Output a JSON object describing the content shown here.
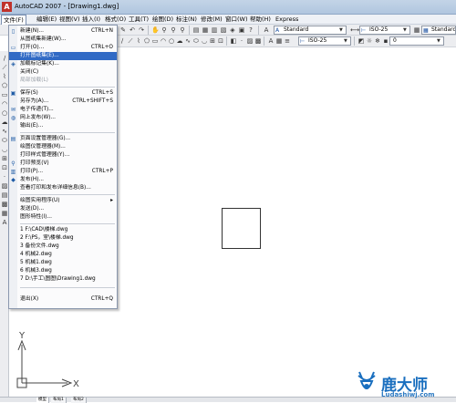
{
  "window": {
    "title": "AutoCAD 2007 - [Drawing1.dwg]",
    "app_icon_letter": "A"
  },
  "menubar": [
    {
      "label": "文件(F)",
      "active": true
    },
    {
      "label": "编辑(E)"
    },
    {
      "label": "视图(V)"
    },
    {
      "label": "插入(I)"
    },
    {
      "label": "格式(O)"
    },
    {
      "label": "工具(T)"
    },
    {
      "label": "绘图(D)"
    },
    {
      "label": "标注(N)"
    },
    {
      "label": "修改(M)"
    },
    {
      "label": "窗口(W)"
    },
    {
      "label": "帮助(H)"
    },
    {
      "label": "Express"
    }
  ],
  "toolbar": {
    "text_style": "Standard",
    "dim_style": "ISO-25",
    "table_style": "Standard",
    "layer": "0"
  },
  "file_menu": {
    "items": [
      {
        "label": "新建(N)...",
        "shortcut": "CTRL+N",
        "icon": "new-file-icon"
      },
      {
        "label": "从图纸集新建(W)...",
        "shortcut": "",
        "icon": ""
      },
      {
        "label": "打开(O)...",
        "shortcut": "CTRL+O",
        "icon": "open-folder-icon"
      },
      {
        "label": "打开图纸集(E)...",
        "shortcut": "",
        "icon": "",
        "highlighted": true
      },
      {
        "label": "加载标记集(K)...",
        "shortcut": "",
        "icon": "markup-icon"
      },
      {
        "label": "关闭(C)",
        "shortcut": "",
        "icon": ""
      },
      {
        "label": "局部加载(L)",
        "shortcut": "",
        "icon": "",
        "disabled": true
      },
      {
        "label": "保存(S)",
        "shortcut": "CTRL+S",
        "icon": "save-icon"
      },
      {
        "label": "另存为(A)...",
        "shortcut": "CTRL+SHIFT+S",
        "icon": ""
      },
      {
        "label": "电子传递(T)...",
        "shortcut": "",
        "icon": "etransmit-icon"
      },
      {
        "label": "网上发布(W)...",
        "shortcut": "",
        "icon": "publish-web-icon"
      },
      {
        "label": "输出(E)...",
        "shortcut": "",
        "icon": ""
      },
      {
        "label": "页面设置管理器(G)...",
        "shortcut": "",
        "icon": "page-setup-icon"
      },
      {
        "label": "绘图仪管理器(M)...",
        "shortcut": "",
        "icon": ""
      },
      {
        "label": "打印样式管理器(Y)...",
        "shortcut": "",
        "icon": ""
      },
      {
        "label": "打印预览(V)",
        "shortcut": "",
        "icon": "print-preview-icon"
      },
      {
        "label": "打印(P)...",
        "shortcut": "CTRL+P",
        "icon": "print-icon"
      },
      {
        "label": "发布(H)...",
        "shortcut": "",
        "icon": "publish-icon"
      },
      {
        "label": "查看打印和发布详细信息(B)...",
        "shortcut": "",
        "icon": ""
      },
      {
        "label": "绘图实用程序(U)",
        "shortcut": "",
        "icon": "",
        "submenu": true
      },
      {
        "label": "发送(D)...",
        "shortcut": "",
        "icon": ""
      },
      {
        "label": "图形特性(I)...",
        "shortcut": "",
        "icon": ""
      },
      {
        "label": "1 F:\\CAD\\楼梯.dwg",
        "shortcut": "",
        "icon": ""
      },
      {
        "label": "2 F:\\PS，室\\楼梯.dwg",
        "shortcut": "",
        "icon": ""
      },
      {
        "label": "3 备份文件.dwg",
        "shortcut": "",
        "icon": ""
      },
      {
        "label": "4 机械2.dwg",
        "shortcut": "",
        "icon": ""
      },
      {
        "label": "5 机械1.dwg",
        "shortcut": "",
        "icon": ""
      },
      {
        "label": "6 机械3.dwg",
        "shortcut": "",
        "icon": ""
      },
      {
        "label": "7 D:\\手工\\图图\\Drawing1.dwg",
        "shortcut": "",
        "icon": ""
      },
      {
        "label": "退出(X)",
        "shortcut": "CTRL+Q",
        "icon": ""
      }
    ]
  },
  "ucs": {
    "x_label": "X",
    "y_label": "Y"
  },
  "tabs": [
    "模型",
    "布局1",
    "布局2"
  ],
  "watermark": {
    "text": "鹿大师",
    "url": "Ludashiwj.com"
  },
  "colors": {
    "highlight": "#316ac5",
    "title_bar": "#b0c6df",
    "watermark": "#1a6fbf"
  }
}
